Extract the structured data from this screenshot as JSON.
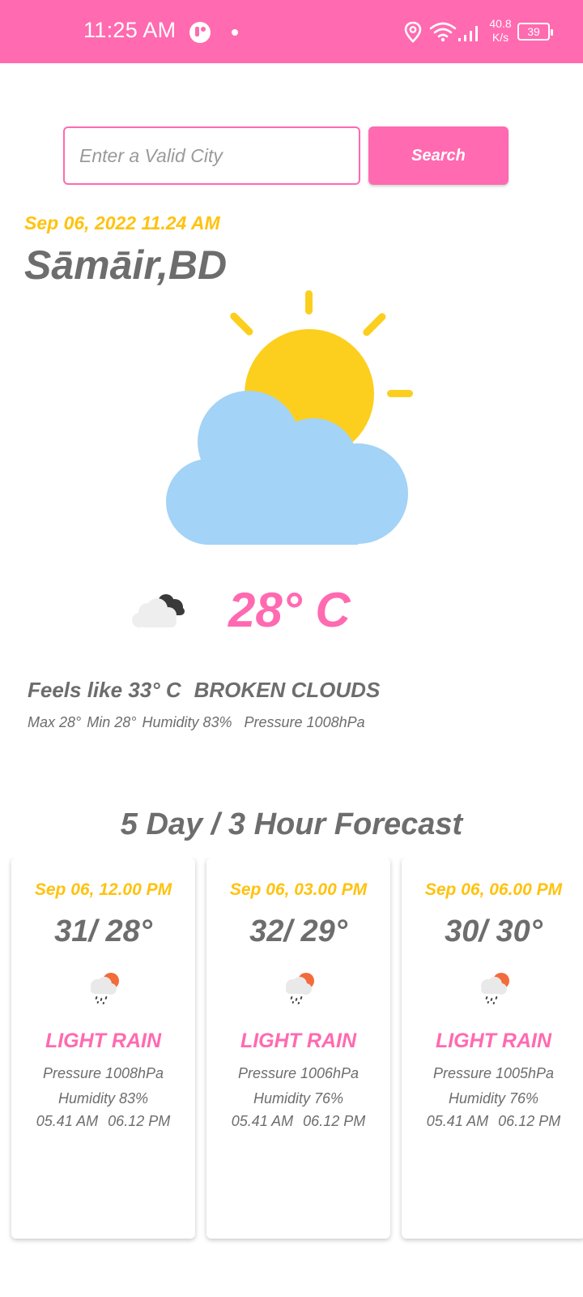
{
  "status_bar": {
    "time": "11:25 AM",
    "speed_value": "40.8",
    "speed_unit": "K/s",
    "battery": "39"
  },
  "search": {
    "placeholder": "Enter a Valid City",
    "value": "",
    "button_label": "Search"
  },
  "current": {
    "datetime": "Sep 06, 2022 11.24 AM",
    "city": "Sāmāir,BD",
    "temperature": "28° C",
    "feels_like": "Feels like 33° C",
    "condition": "BROKEN CLOUDS",
    "max": "Max 28°",
    "min": "Min 28°",
    "humidity": "Humidity 83%",
    "pressure": "Pressure 1008hPa"
  },
  "forecast": {
    "title": "5 Day / 3 Hour Forecast",
    "cards": [
      {
        "time": "Sep 06, 12.00 PM",
        "temp": "31/ 28°",
        "condition": "LIGHT RAIN",
        "pressure": "Pressure 1008hPa",
        "humidity": "Humidity 83%",
        "sunrise": "05.41 AM",
        "sunset": "06.12 PM"
      },
      {
        "time": "Sep 06, 03.00 PM",
        "temp": "32/ 29°",
        "condition": "LIGHT RAIN",
        "pressure": "Pressure 1006hPa",
        "humidity": "Humidity 76%",
        "sunrise": "05.41 AM",
        "sunset": "06.12 PM"
      },
      {
        "time": "Sep 06, 06.00 PM",
        "temp": "30/ 30°",
        "condition": "LIGHT RAIN",
        "pressure": "Pressure 1005hPa",
        "humidity": "Humidity 76%",
        "sunrise": "05.41 AM",
        "sunset": "06.12 PM"
      }
    ]
  },
  "icons": {
    "hero": "sun-behind-cloud-icon",
    "current_small": "broken-clouds-icon",
    "forecast": "light-rain-icon"
  },
  "colors": {
    "accent": "#ff6ab0",
    "date": "#ffc20e",
    "text": "#6d6d6d"
  }
}
